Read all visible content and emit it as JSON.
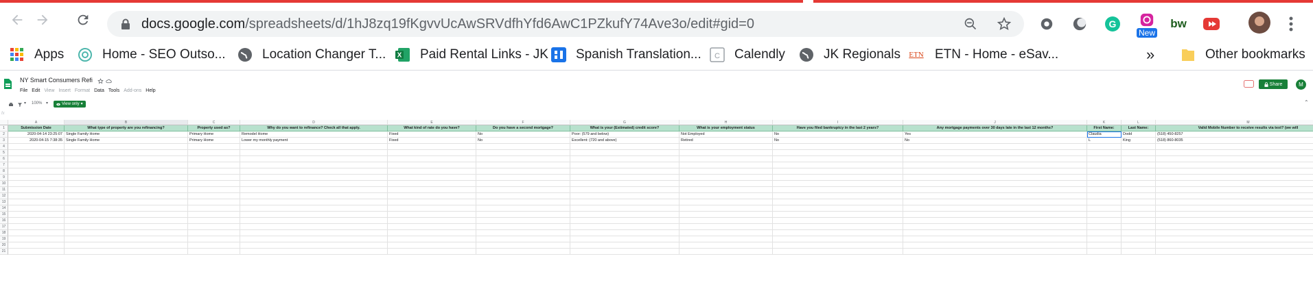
{
  "browser": {
    "url_host": "docs.google.com",
    "url_path": "/spreadsheets/d/1hJ8zq19fKgvvUcAwSRVdfhYfd6AwC1PZkufY74Ave3o/edit#gid=0",
    "badge_new": "New",
    "bw_label": "bw"
  },
  "bookmarks": {
    "items": [
      {
        "label": "Apps",
        "icon": "apps-grid-icon"
      },
      {
        "label": "Home - SEO Outso...",
        "icon": "swirl-icon"
      },
      {
        "label": "Location Changer T...",
        "icon": "globe-icon"
      },
      {
        "label": "Paid Rental Links - JK",
        "icon": "excel-icon"
      },
      {
        "label": "Spanish Translation...",
        "icon": "bars-icon"
      },
      {
        "label": "Calendly",
        "icon": "calendar-icon"
      },
      {
        "label": "JK Regionals",
        "icon": "globe-icon"
      },
      {
        "label": "ETN - Home - eSav...",
        "icon": "etn-logo-icon"
      }
    ],
    "overflow": "»",
    "other": "Other bookmarks",
    "etn_text": "ETN"
  },
  "sheet": {
    "title": "NY Smart Consumers Refi",
    "menus": [
      "File",
      "Edit",
      "View",
      "Insert",
      "Format",
      "Data",
      "Tools",
      "Add-ons",
      "Help"
    ],
    "share_label": "Share",
    "avatar_letter": "M",
    "zoom": "100%",
    "view_only": "View only",
    "fx": "fx"
  },
  "grid": {
    "columns": [
      "A",
      "B",
      "C",
      "D",
      "E",
      "F",
      "G",
      "H",
      "I",
      "J",
      "K",
      "L",
      "M"
    ],
    "headers": [
      "Submission Date",
      "What type of property are you refinancing?",
      "Property used as?",
      "Why do you want to refinance? Check all that apply.",
      "What kind of rate do you have?",
      "Do you have a second mortgage?",
      "What is your (Estimated) credit score?",
      "What is your employment status",
      "Have you filed bankruptcy in the last 2 years?",
      "Any mortgage payments over 30 days late in the last 12 months?",
      "First Name:",
      "Last Name:",
      "Valid Mobile Number to receive results via text? (we will"
    ],
    "rows": [
      [
        "2020-04-14 23:25:07",
        "Single Family Home",
        "Primary Home",
        "Remodel Home",
        "Fixed",
        "No",
        "Poor: (579 and below)",
        "Not Employed",
        "No",
        "Yes",
        "Claudia",
        "Dodd",
        "(518) 450-8257"
      ],
      [
        "2020-04-15 7:38:35",
        "Single Family Home",
        "Primary Home",
        "Lower my monthly payment",
        "Fixed",
        "No",
        "Excellent: (720 and above)",
        "Retired",
        "No",
        "No",
        "L",
        "King",
        "(518) 860-8035"
      ]
    ],
    "row_numbers": [
      "1",
      "2",
      "3",
      "4",
      "5",
      "6",
      "7",
      "8",
      "9",
      "10",
      "11",
      "12",
      "13",
      "14",
      "15",
      "16",
      "17",
      "18",
      "19",
      "20",
      "21"
    ]
  },
  "colors": {
    "header_fill": "#b7e1cd",
    "share_button": "#188038",
    "tab_red": "#e53935"
  }
}
